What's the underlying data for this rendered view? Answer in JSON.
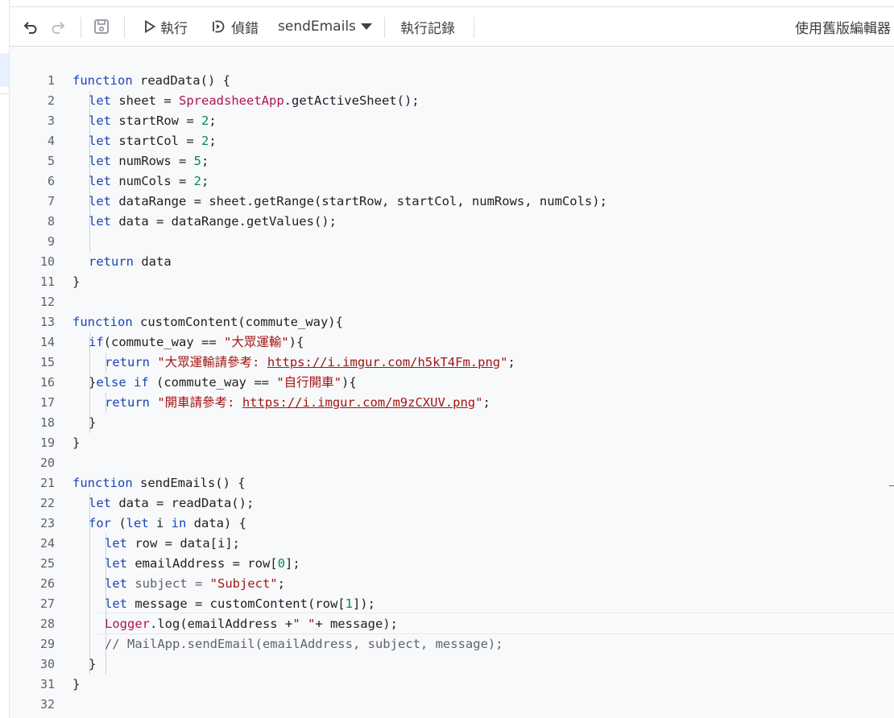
{
  "toolbar": {
    "undo_icon": "undo-icon",
    "redo_icon": "redo-icon",
    "save_icon": "save-icon",
    "run_label": "執行",
    "debug_label": "偵錯",
    "function_select": "sendEmails",
    "exec_log_label": "執行記錄",
    "legacy_editor_label": "使用舊版編輯器"
  },
  "editor": {
    "line_numbers": [
      "1",
      "2",
      "3",
      "4",
      "5",
      "6",
      "7",
      "8",
      "9",
      "10",
      "11",
      "12",
      "13",
      "14",
      "15",
      "16",
      "17",
      "18",
      "19",
      "20",
      "21",
      "22",
      "23",
      "24",
      "25",
      "26",
      "27",
      "28",
      "29",
      "30",
      "31",
      "32"
    ]
  },
  "code": {
    "l1": {
      "a": "function",
      "b": " readData() {"
    },
    "l2": {
      "a": "let",
      "b": " sheet = ",
      "c": "SpreadsheetApp",
      "d": ".getActiveSheet();"
    },
    "l3": {
      "a": "let",
      "b": " startRow = ",
      "c": "2",
      "d": ";"
    },
    "l4": {
      "a": "let",
      "b": " startCol = ",
      "c": "2",
      "d": ";"
    },
    "l5": {
      "a": "let",
      "b": " numRows = ",
      "c": "5",
      "d": ";"
    },
    "l6": {
      "a": "let",
      "b": " numCols = ",
      "c": "2",
      "d": ";"
    },
    "l7": {
      "a": "let",
      "b": " dataRange = sheet.getRange(startRow, startCol, numRows, numCols);"
    },
    "l8": {
      "a": "let",
      "b": " data = dataRange.getValues();"
    },
    "l10": {
      "a": "return",
      "b": " data"
    },
    "l11": {
      "a": "}"
    },
    "l13": {
      "a": "function",
      "b": " customContent(commute_way){"
    },
    "l14": {
      "a": "if",
      "b": "(commute_way == ",
      "c": "\"大眾運輸\"",
      "d": "){"
    },
    "l15": {
      "a": "return",
      "b": " ",
      "c": "\"大眾運輸請參考: ",
      "d": "https://i.imgur.com/h5kT4Fm.png",
      "e": "\"",
      "f": ";"
    },
    "l16": {
      "a": "}",
      "b": "else",
      "c": " ",
      "d": "if",
      "e": " (commute_way == ",
      "f": "\"自行開車\"",
      "g": "){"
    },
    "l17": {
      "a": "return",
      "b": " ",
      "c": "\"開車請參考: ",
      "d": "https://i.imgur.com/m9zCXUV.png",
      "e": "\"",
      "f": ";"
    },
    "l18": {
      "a": "}"
    },
    "l19": {
      "a": "}"
    },
    "l21": {
      "a": "function",
      "b": " sendEmails() {"
    },
    "l22": {
      "a": "let",
      "b": " data = readData();"
    },
    "l23": {
      "a": "for",
      "b": " (",
      "c": "let",
      "d": " i ",
      "e": "in",
      "f": " data) {"
    },
    "l24": {
      "a": "let",
      "b": " row = data[i];"
    },
    "l25": {
      "a": "let",
      "b": " emailAddress = row[",
      "c": "0",
      "d": "];"
    },
    "l26": {
      "a": "let",
      "b": " subject = ",
      "c": "\"Subject\"",
      "d": ";"
    },
    "l27": {
      "a": "let",
      "b": " message = customContent(row[",
      "c": "1",
      "d": "]);"
    },
    "l28": {
      "a": "Logger",
      "b": ".log(emailAddress +",
      "c": "\" \"",
      "d": "+ message);"
    },
    "l29": {
      "a": "// MailApp.sendEmail(emailAddress, subject, message);"
    },
    "l30": {
      "a": "}"
    },
    "l31": {
      "a": "}"
    }
  }
}
